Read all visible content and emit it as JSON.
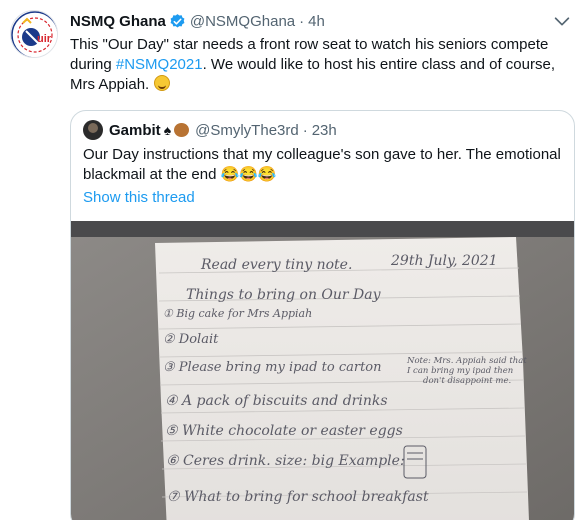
{
  "tweet": {
    "author_name": "NSMQ Ghana",
    "author_handle": "@NSMQGhana",
    "separator": "·",
    "time": "4h",
    "text_part1": "This \"Our Day\" star needs a front row seat to watch his seniors compete during ",
    "hashtag": "#NSMQ2021",
    "text_part2": ". We would like to host his entire class and of course, Mrs Appiah. ",
    "avatar_text": "NSMQ",
    "icons": [
      "verified-badge-icon",
      "more-options-icon",
      "grinning-face-emoji"
    ]
  },
  "quoted_tweet": {
    "author_name": "Gambit",
    "author_emoji_1": "♠",
    "author_handle": "@SmylyThe3rd",
    "separator": "·",
    "time": "23h",
    "text": "Our Day instructions that my colleague's son gave to her. The emotional blackmail at the end 😂😂😂",
    "show_thread": "Show this thread"
  },
  "note": {
    "line0_left": "Read every tiny note.",
    "line0_right": "29th July, 2021",
    "line1": "Things to bring on Our Day",
    "line2": "① Big cake for Mrs Appiah",
    "line3": "② Dolait",
    "line4": "③ Please bring my ipad to carton",
    "side_note_1": "Note: Mrs. Appiah said that",
    "side_note_2": "I can bring my ipad then",
    "side_note_3": "don't disappoint me.",
    "line5": "④ A pack of biscuits and drinks",
    "line6": "⑤ White chocolate or easter eggs",
    "line7": "⑥ Ceres drink. size: big Example:",
    "line8": "⑦ What to bring for school breakfast"
  },
  "colors": {
    "accent": "#1d9bf0",
    "text_primary": "#0f1419",
    "text_secondary": "#536471",
    "border": "#cfd9de",
    "paper": "#ebe8e6",
    "pencil": "#5b5b66"
  }
}
